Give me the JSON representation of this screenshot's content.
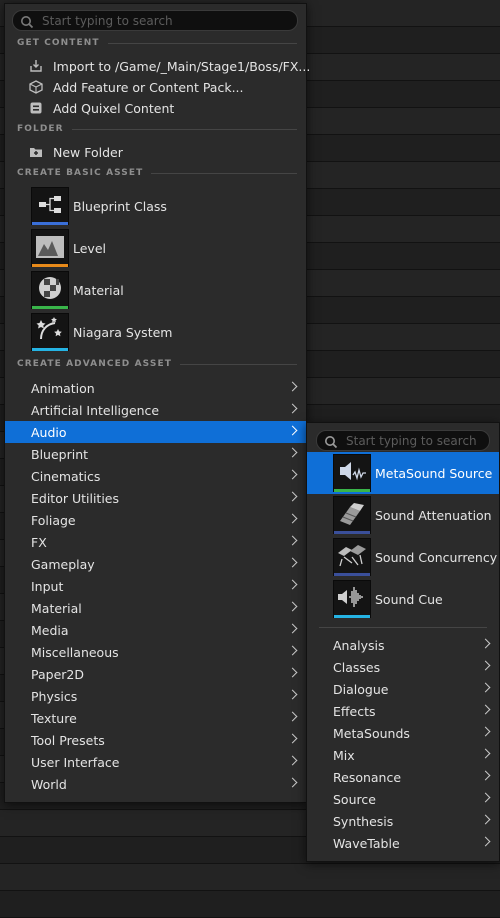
{
  "main_menu": {
    "search_placeholder": "Start typing to search",
    "get_content": {
      "header": "GET CONTENT",
      "items": [
        {
          "label": "Import to /Game/_Main/Stage1/Boss/FX...",
          "icon": "import-icon"
        },
        {
          "label": "Add Feature or Content Pack...",
          "icon": "content-pack-icon"
        },
        {
          "label": "Add Quixel Content",
          "icon": "quixel-icon"
        }
      ]
    },
    "folder": {
      "header": "FOLDER",
      "items": [
        {
          "label": "New Folder",
          "icon": "new-folder-icon"
        }
      ]
    },
    "basic_assets": {
      "header": "CREATE BASIC ASSET",
      "items": [
        {
          "label": "Blueprint Class",
          "icon": "blueprint-class-icon",
          "color": "#3a6fd8"
        },
        {
          "label": "Level",
          "icon": "level-icon",
          "color": "#e88a1a"
        },
        {
          "label": "Material",
          "icon": "material-icon",
          "color": "#39b54a"
        },
        {
          "label": "Niagara System",
          "icon": "niagara-system-icon",
          "color": "#25b3e3"
        }
      ]
    },
    "advanced_assets": {
      "header": "CREATE ADVANCED ASSET",
      "categories": [
        "Animation",
        "Artificial Intelligence",
        "Audio",
        "Blueprint",
        "Cinematics",
        "Editor Utilities",
        "Foliage",
        "FX",
        "Gameplay",
        "Input",
        "Material",
        "Media",
        "Miscellaneous",
        "Paper2D",
        "Physics",
        "Texture",
        "Tool Presets",
        "User Interface",
        "World"
      ],
      "selected": "Audio"
    }
  },
  "audio_submenu": {
    "search_placeholder": "Start typing to search",
    "assets": [
      {
        "label": "MetaSound Source",
        "icon": "metasound-source-icon",
        "color": "#39b54a"
      },
      {
        "label": "Sound Attenuation",
        "icon": "sound-attenuation-icon",
        "color": "#3a4f9a"
      },
      {
        "label": "Sound Concurrency",
        "icon": "sound-concurrency-icon",
        "color": "#3a4f9a"
      },
      {
        "label": "Sound Cue",
        "icon": "sound-cue-icon",
        "color": "#25b3e3"
      }
    ],
    "selected": "MetaSound Source",
    "categories": [
      "Analysis",
      "Classes",
      "Dialogue",
      "Effects",
      "MetaSounds",
      "Mix",
      "Resonance",
      "Source",
      "Synthesis",
      "WaveTable"
    ]
  },
  "colors": {
    "selection": "#0f6fd7",
    "menu_bg": "#2b2b2b"
  }
}
